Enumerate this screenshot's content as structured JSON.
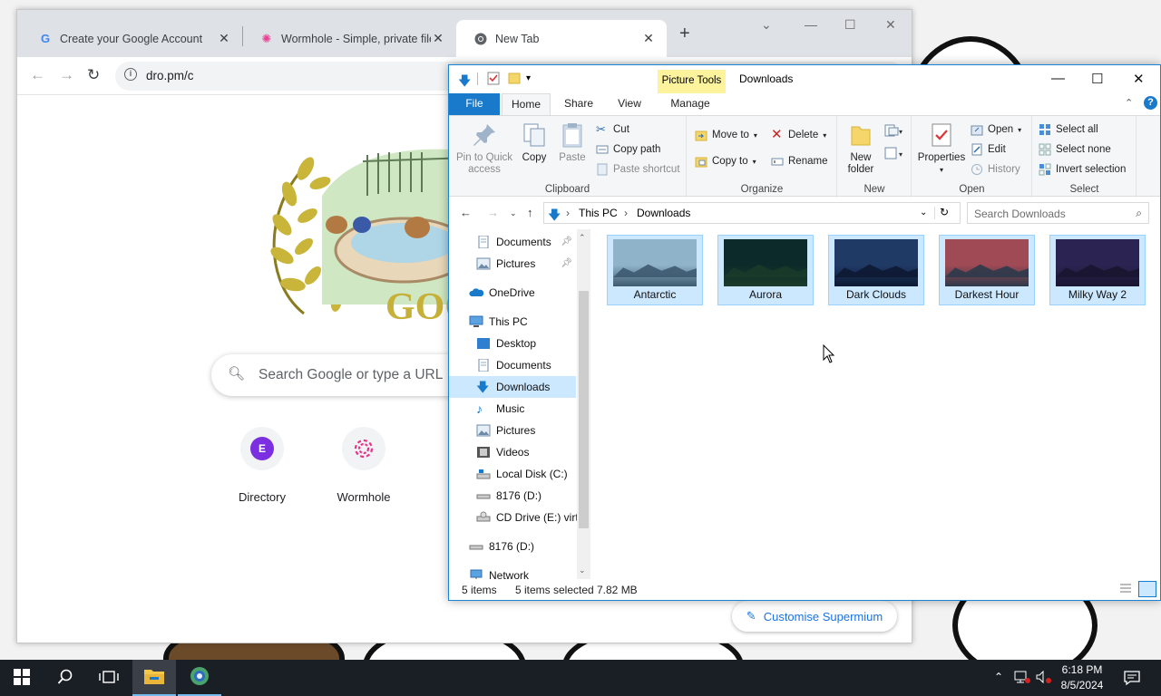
{
  "chrome": {
    "tabs": [
      {
        "title": "Create your Google Account",
        "favicon": "google-g-icon"
      },
      {
        "title": "Wormhole - Simple, private file",
        "favicon": "wormhole-icon"
      },
      {
        "title": "New Tab",
        "favicon": "chrome-icon"
      }
    ],
    "url": "dro.pm/c",
    "search_placeholder": "Search Google or type a URL",
    "doodle_text": "GOO",
    "shortcuts": [
      {
        "label": "Directory",
        "badge": "E"
      },
      {
        "label": "Wormhole",
        "badge": ""
      }
    ],
    "customise_label": "Customise Supermium"
  },
  "explorer": {
    "title": "Downloads",
    "contextual_tab": "Picture Tools",
    "ribbon_tabs": [
      "File",
      "Home",
      "Share",
      "View",
      "Manage"
    ],
    "clipboard": {
      "group": "Clipboard",
      "pin": "Pin to Quick access",
      "copy": "Copy",
      "paste": "Paste",
      "cut": "Cut",
      "copy_path": "Copy path",
      "paste_shortcut": "Paste shortcut"
    },
    "organize": {
      "group": "Organize",
      "move_to": "Move to",
      "copy_to": "Copy to",
      "delete": "Delete",
      "rename": "Rename"
    },
    "new": {
      "group": "New",
      "new_folder": "New folder"
    },
    "open": {
      "group": "Open",
      "properties": "Properties",
      "open": "Open",
      "edit": "Edit",
      "history": "History"
    },
    "select": {
      "group": "Select",
      "select_all": "Select all",
      "select_none": "Select none",
      "invert": "Invert selection"
    },
    "breadcrumb": [
      "This PC",
      "Downloads"
    ],
    "search_placeholder": "Search Downloads",
    "nav": [
      {
        "label": "Documents",
        "pinned": true,
        "icon": "documents-icon"
      },
      {
        "label": "Pictures",
        "pinned": true,
        "icon": "pictures-icon"
      },
      {
        "label": "OneDrive",
        "icon": "onedrive-icon"
      },
      {
        "label": "This PC",
        "icon": "this-pc-icon"
      },
      {
        "label": "Desktop",
        "icon": "desktop-icon"
      },
      {
        "label": "Documents",
        "icon": "documents-icon"
      },
      {
        "label": "Downloads",
        "icon": "downloads-icon",
        "selected": true
      },
      {
        "label": "Music",
        "icon": "music-icon"
      },
      {
        "label": "Pictures",
        "icon": "pictures-icon"
      },
      {
        "label": "Videos",
        "icon": "videos-icon"
      },
      {
        "label": "Local Disk (C:)",
        "icon": "local-disk-icon"
      },
      {
        "label": "8176 (D:)",
        "icon": "drive-icon"
      },
      {
        "label": "CD Drive (E:) virt",
        "icon": "cd-drive-icon"
      },
      {
        "label": "8176 (D:)",
        "icon": "drive-icon"
      },
      {
        "label": "Network",
        "icon": "network-icon"
      }
    ],
    "files": [
      {
        "name": "Antarctic",
        "sky": "#8fb3c9",
        "ground": "#3d5a70"
      },
      {
        "name": "Aurora",
        "sky": "#0d2a2a",
        "ground": "#1a3b2a"
      },
      {
        "name": "Dark Clouds",
        "sky": "#203a66",
        "ground": "#0e1a33"
      },
      {
        "name": "Darkest Hour",
        "sky": "#a04a55",
        "ground": "#2d3a4a"
      },
      {
        "name": "Milky Way 2",
        "sky": "#2b2452",
        "ground": "#1a1530"
      }
    ],
    "status": {
      "items": "5 items",
      "selected": "5 items selected",
      "size": "7.82 MB"
    }
  },
  "taskbar": {
    "time": "6:18 PM",
    "date": "8/5/2024"
  },
  "colors": {
    "accent": "#1979ca",
    "selection": "#cce8ff",
    "taskbar": "#1a1f26"
  }
}
